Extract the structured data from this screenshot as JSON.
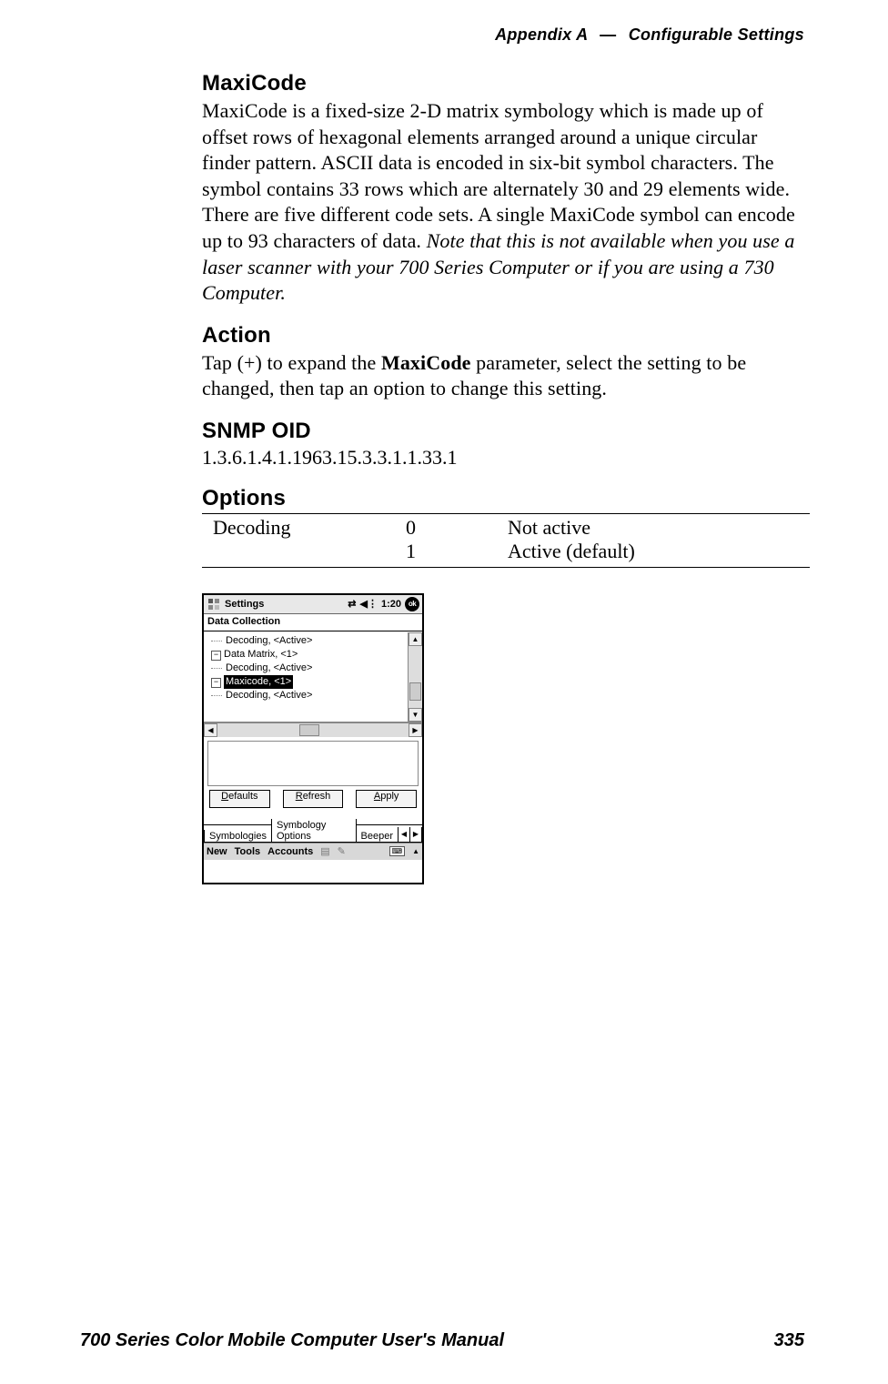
{
  "header": {
    "appendix": "Appendix A",
    "dash": "—",
    "section": "Configurable Settings"
  },
  "h_maxicode": "MaxiCode",
  "p_maxicode_a": "MaxiCode is a fixed-size 2-D matrix symbology which is made up of offset rows of hexagonal elements arranged around a unique circular finder pattern. ASCII data is encoded in six-bit symbol characters. The symbol contains 33 rows which are alternately 30 and 29 elements wide. There are five different code sets. A single MaxiCode symbol can encode up to 93 characters of data. ",
  "p_maxicode_note": "Note that this is not available when you use a laser scanner with your 700 Series Computer or if you are using a 730 Computer.",
  "h_action": "Action",
  "p_action_a": "Tap (+) to expand the ",
  "p_action_bold": "MaxiCode",
  "p_action_b": " parameter, select the setting to be changed, then tap an option to change this setting.",
  "h_snmp": "SNMP OID",
  "snmp_oid": "1.3.6.1.4.1.1963.15.3.3.1.1.33.1",
  "h_options": "Options",
  "options": {
    "name": "Decoding",
    "rows": [
      {
        "val": "0",
        "desc": "Not active"
      },
      {
        "val": "1",
        "desc": "Active (default)"
      }
    ]
  },
  "shot": {
    "title": "Settings",
    "time": "1:20",
    "ok": "ok",
    "subtitle": "Data Collection",
    "tree": {
      "r1": "Decoding, <Active>",
      "r2": "Data Matrix, <1>",
      "r3": "Decoding, <Active>",
      "r4": "Maxicode, <1>",
      "r5": "Decoding, <Active>"
    },
    "buttons": {
      "defaults": "efaults",
      "defaults_u": "D",
      "refresh": "efresh",
      "refresh_u": "R",
      "apply": "pply",
      "apply_u": "A"
    },
    "tabs": {
      "t1": "Symbologies",
      "t2": "Symbology Options",
      "t3": "Beeper"
    },
    "menu": {
      "m1": "New",
      "m2": "Tools",
      "m3": "Accounts"
    }
  },
  "footer": {
    "left": "700 Series Color Mobile Computer User's Manual",
    "right": "335"
  }
}
